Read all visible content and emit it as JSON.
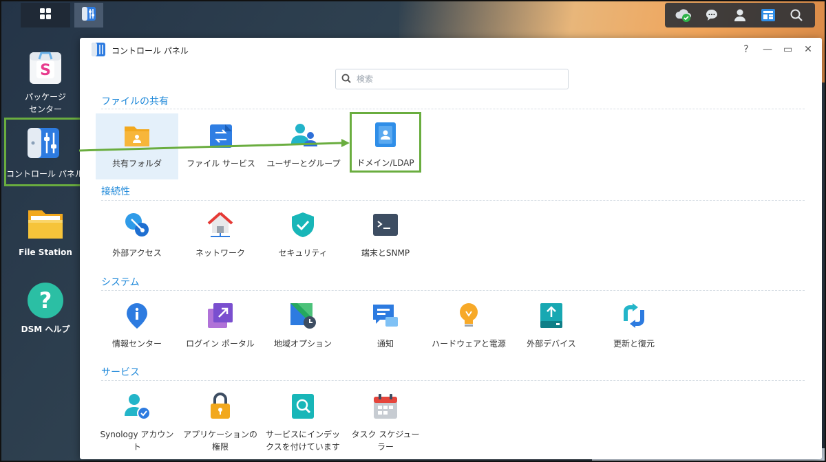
{
  "taskbar": {
    "left_buttons": [
      {
        "name": "main-menu",
        "icon": "grid-icon"
      },
      {
        "name": "control-panel-task",
        "icon": "control-panel-icon"
      }
    ],
    "right_icons": [
      "cloud-check-icon",
      "chat-icon",
      "user-icon",
      "widgets-icon",
      "search-icon"
    ]
  },
  "desktop": {
    "shortcuts": [
      {
        "label_1": "パッケージ",
        "label_2": "センター",
        "icon": "package-center-icon"
      },
      {
        "label_1": "コントロール パネル",
        "icon": "control-panel-icon"
      },
      {
        "label_1": "File Station",
        "icon": "folder-icon"
      },
      {
        "label_1": "DSM ヘルプ",
        "icon": "help-icon"
      }
    ]
  },
  "window": {
    "title": "コントロール パネル",
    "controls": {
      "help": "?",
      "minimize": "—",
      "maximize": "▭",
      "close": "✕"
    },
    "search_placeholder": "検索",
    "sections": [
      {
        "title": "ファイルの共有",
        "items": [
          {
            "label": "共有フォルダ",
            "icon": "shared-folder-icon"
          },
          {
            "label": "ファイル サービス",
            "icon": "file-services-icon"
          },
          {
            "label": "ユーザーとグループ",
            "icon": "users-groups-icon"
          },
          {
            "label": "ドメイン/LDAP",
            "icon": "domain-ldap-icon"
          }
        ]
      },
      {
        "title": "接続性",
        "items": [
          {
            "label": "外部アクセス",
            "icon": "external-access-icon"
          },
          {
            "label": "ネットワーク",
            "icon": "network-icon"
          },
          {
            "label": "セキュリティ",
            "icon": "security-shield-icon"
          },
          {
            "label": "端末とSNMP",
            "icon": "terminal-icon"
          }
        ]
      },
      {
        "title": "システム",
        "items": [
          {
            "label": "情報センター",
            "icon": "info-center-icon"
          },
          {
            "label": "ログイン ポータル",
            "icon": "login-portal-icon"
          },
          {
            "label": "地域オプション",
            "icon": "regional-options-icon"
          },
          {
            "label": "通知",
            "icon": "notification-icon"
          },
          {
            "label": "ハードウェアと電源",
            "icon": "hardware-power-icon"
          },
          {
            "label": "外部デバイス",
            "icon": "external-devices-icon"
          },
          {
            "label": "更新と復元",
            "icon": "update-restore-icon"
          }
        ]
      },
      {
        "title": "サービス",
        "items": [
          {
            "label_1": "Synology アカウン",
            "label_2": "ト",
            "icon": "synology-account-icon"
          },
          {
            "label_1": "アプリケーションの",
            "label_2": "権限",
            "icon": "app-privileges-icon"
          },
          {
            "label_1": "サービスにインデッ",
            "label_2": "クスを付けています",
            "icon": "indexing-service-icon"
          },
          {
            "label_1": "タスク スケジュー",
            "label_2": "ラー",
            "icon": "task-scheduler-icon"
          }
        ]
      }
    ]
  },
  "colors": {
    "accent": "#1e88d9",
    "annotation_green": "#6aad3f",
    "selected_item_bg": "#e4f0fa"
  }
}
